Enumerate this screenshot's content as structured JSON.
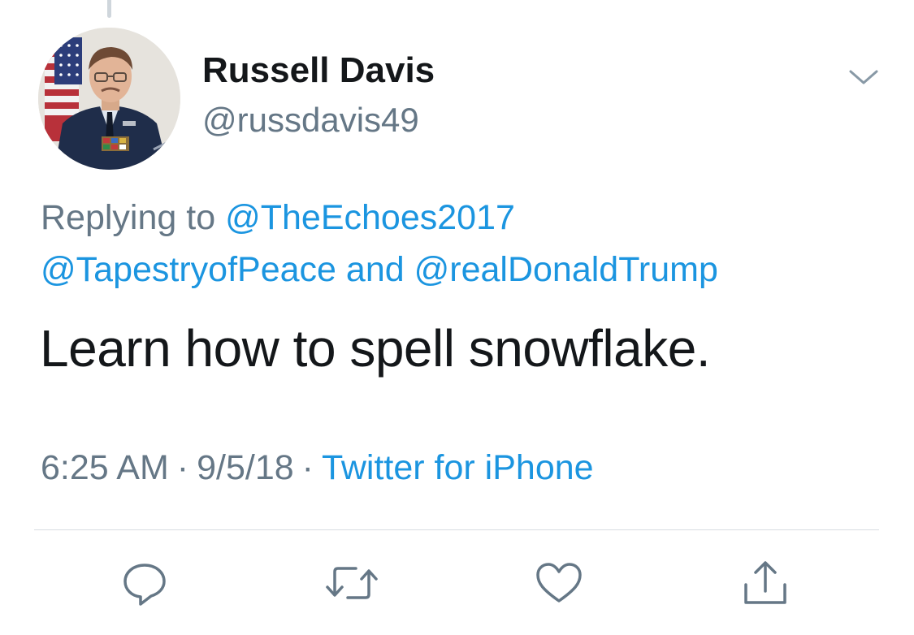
{
  "tweet": {
    "author_name": "Russell Davis",
    "author_handle": "@russdavis49",
    "replying_prefix": "Replying to",
    "reply_mentions": [
      "@TheEchoes2017",
      "@TapestryofPeace",
      "@realDonaldTrump"
    ],
    "mention_joiner": "and",
    "text": "Learn how to spell snowflake.",
    "time": "6:25 AM",
    "date": "9/5/18",
    "separator": "·",
    "source": "Twitter for iPhone"
  },
  "icons": {
    "caret": "chevron-down-icon",
    "reply": "reply-icon",
    "retweet": "retweet-icon",
    "like": "heart-icon",
    "share": "share-icon"
  },
  "colors": {
    "name": "#14171a",
    "secondary": "#657786",
    "link": "#1b95e0",
    "divider": "#d8dde2"
  }
}
